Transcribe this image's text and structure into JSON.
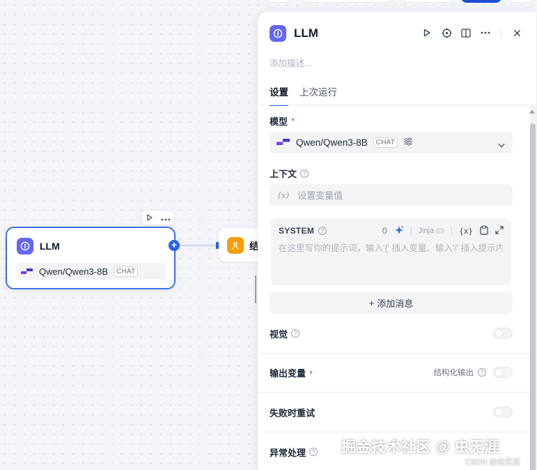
{
  "canvas": {
    "llm_node": {
      "title": "LLM",
      "model": "Qwen/Qwen3-8B",
      "model_tag": "CHAT"
    },
    "next_node": {
      "label_fragment": "结"
    }
  },
  "panel": {
    "title": "LLM",
    "description_placeholder": "添加描述...",
    "tabs": [
      {
        "label": "设置",
        "active": true
      },
      {
        "label": "上次运行",
        "active": false
      }
    ],
    "model": {
      "label": "模型",
      "required_mark": "*",
      "value": "Qwen/Qwen3-8B",
      "tag": "CHAT"
    },
    "context": {
      "label": "上下文",
      "var_icon": "(x)",
      "placeholder": "设置变量值"
    },
    "system": {
      "label": "SYSTEM",
      "count": "0",
      "jinja_label": "Jinja",
      "var_icon": "{x}",
      "placeholder": "在这里写你的提示词，输入'{' 插入变量、输入'/' 插入提示内容块"
    },
    "add_message": {
      "plus": "+",
      "label": "添加消息"
    },
    "vision": {
      "label": "视觉"
    },
    "output_vars": {
      "label": "输出变量",
      "structured_label": "结构化输出"
    },
    "retry": {
      "label": "失败时重试"
    },
    "error_handling": {
      "label": "异常处理"
    }
  },
  "watermark": {
    "text": "掘金技术社区 @ 虫无涯",
    "sub": "CSDN @虫无涯"
  },
  "colors": {
    "accent": "#2563eb",
    "llm_icon": "#6366f1",
    "node2_icon": "#f59e0b"
  }
}
